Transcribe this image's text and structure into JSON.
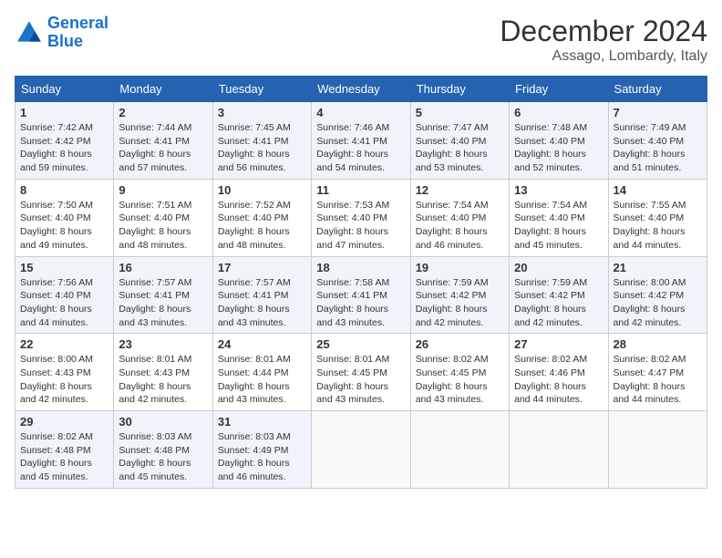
{
  "header": {
    "logo_line1": "General",
    "logo_line2": "Blue",
    "month": "December 2024",
    "location": "Assago, Lombardy, Italy"
  },
  "weekdays": [
    "Sunday",
    "Monday",
    "Tuesday",
    "Wednesday",
    "Thursday",
    "Friday",
    "Saturday"
  ],
  "weeks": [
    [
      {
        "day": "1",
        "sunrise": "7:42 AM",
        "sunset": "4:42 PM",
        "daylight": "8 hours and 59 minutes."
      },
      {
        "day": "2",
        "sunrise": "7:44 AM",
        "sunset": "4:41 PM",
        "daylight": "8 hours and 57 minutes."
      },
      {
        "day": "3",
        "sunrise": "7:45 AM",
        "sunset": "4:41 PM",
        "daylight": "8 hours and 56 minutes."
      },
      {
        "day": "4",
        "sunrise": "7:46 AM",
        "sunset": "4:41 PM",
        "daylight": "8 hours and 54 minutes."
      },
      {
        "day": "5",
        "sunrise": "7:47 AM",
        "sunset": "4:40 PM",
        "daylight": "8 hours and 53 minutes."
      },
      {
        "day": "6",
        "sunrise": "7:48 AM",
        "sunset": "4:40 PM",
        "daylight": "8 hours and 52 minutes."
      },
      {
        "day": "7",
        "sunrise": "7:49 AM",
        "sunset": "4:40 PM",
        "daylight": "8 hours and 51 minutes."
      }
    ],
    [
      {
        "day": "8",
        "sunrise": "7:50 AM",
        "sunset": "4:40 PM",
        "daylight": "8 hours and 49 minutes."
      },
      {
        "day": "9",
        "sunrise": "7:51 AM",
        "sunset": "4:40 PM",
        "daylight": "8 hours and 48 minutes."
      },
      {
        "day": "10",
        "sunrise": "7:52 AM",
        "sunset": "4:40 PM",
        "daylight": "8 hours and 48 minutes."
      },
      {
        "day": "11",
        "sunrise": "7:53 AM",
        "sunset": "4:40 PM",
        "daylight": "8 hours and 47 minutes."
      },
      {
        "day": "12",
        "sunrise": "7:54 AM",
        "sunset": "4:40 PM",
        "daylight": "8 hours and 46 minutes."
      },
      {
        "day": "13",
        "sunrise": "7:54 AM",
        "sunset": "4:40 PM",
        "daylight": "8 hours and 45 minutes."
      },
      {
        "day": "14",
        "sunrise": "7:55 AM",
        "sunset": "4:40 PM",
        "daylight": "8 hours and 44 minutes."
      }
    ],
    [
      {
        "day": "15",
        "sunrise": "7:56 AM",
        "sunset": "4:40 PM",
        "daylight": "8 hours and 44 minutes."
      },
      {
        "day": "16",
        "sunrise": "7:57 AM",
        "sunset": "4:41 PM",
        "daylight": "8 hours and 43 minutes."
      },
      {
        "day": "17",
        "sunrise": "7:57 AM",
        "sunset": "4:41 PM",
        "daylight": "8 hours and 43 minutes."
      },
      {
        "day": "18",
        "sunrise": "7:58 AM",
        "sunset": "4:41 PM",
        "daylight": "8 hours and 43 minutes."
      },
      {
        "day": "19",
        "sunrise": "7:59 AM",
        "sunset": "4:42 PM",
        "daylight": "8 hours and 42 minutes."
      },
      {
        "day": "20",
        "sunrise": "7:59 AM",
        "sunset": "4:42 PM",
        "daylight": "8 hours and 42 minutes."
      },
      {
        "day": "21",
        "sunrise": "8:00 AM",
        "sunset": "4:42 PM",
        "daylight": "8 hours and 42 minutes."
      }
    ],
    [
      {
        "day": "22",
        "sunrise": "8:00 AM",
        "sunset": "4:43 PM",
        "daylight": "8 hours and 42 minutes."
      },
      {
        "day": "23",
        "sunrise": "8:01 AM",
        "sunset": "4:43 PM",
        "daylight": "8 hours and 42 minutes."
      },
      {
        "day": "24",
        "sunrise": "8:01 AM",
        "sunset": "4:44 PM",
        "daylight": "8 hours and 43 minutes."
      },
      {
        "day": "25",
        "sunrise": "8:01 AM",
        "sunset": "4:45 PM",
        "daylight": "8 hours and 43 minutes."
      },
      {
        "day": "26",
        "sunrise": "8:02 AM",
        "sunset": "4:45 PM",
        "daylight": "8 hours and 43 minutes."
      },
      {
        "day": "27",
        "sunrise": "8:02 AM",
        "sunset": "4:46 PM",
        "daylight": "8 hours and 44 minutes."
      },
      {
        "day": "28",
        "sunrise": "8:02 AM",
        "sunset": "4:47 PM",
        "daylight": "8 hours and 44 minutes."
      }
    ],
    [
      {
        "day": "29",
        "sunrise": "8:02 AM",
        "sunset": "4:48 PM",
        "daylight": "8 hours and 45 minutes."
      },
      {
        "day": "30",
        "sunrise": "8:03 AM",
        "sunset": "4:48 PM",
        "daylight": "8 hours and 45 minutes."
      },
      {
        "day": "31",
        "sunrise": "8:03 AM",
        "sunset": "4:49 PM",
        "daylight": "8 hours and 46 minutes."
      },
      null,
      null,
      null,
      null
    ]
  ]
}
